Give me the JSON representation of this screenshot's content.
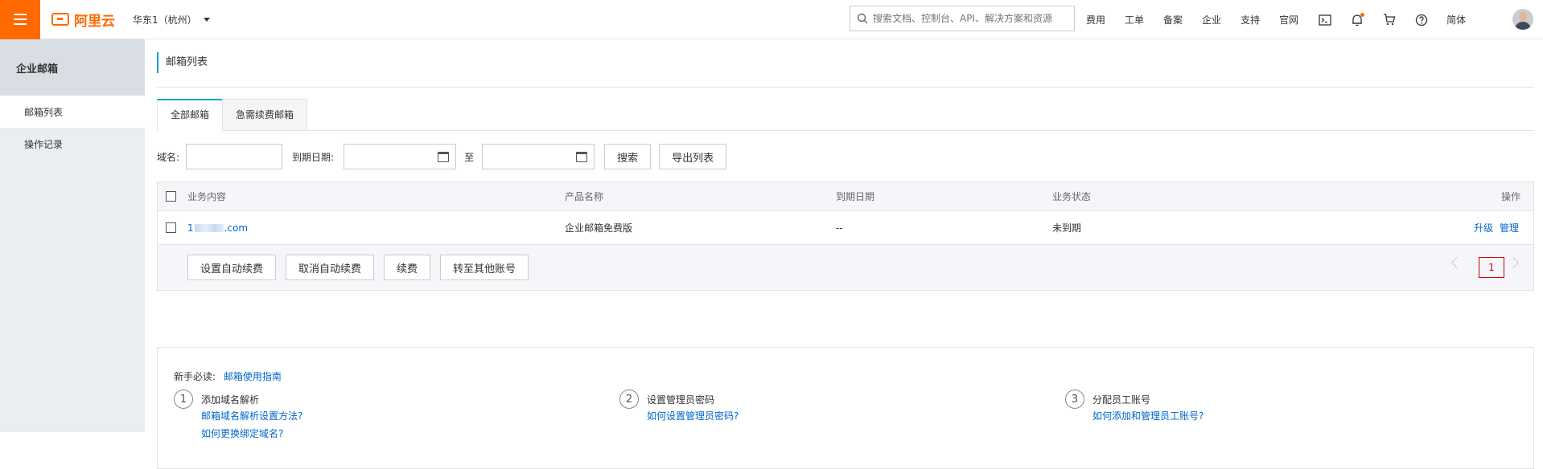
{
  "header": {
    "logo_text": "阿里云",
    "region": "华东1（杭州）",
    "search_placeholder": "搜索文档、控制台、API、解决方案和资源",
    "nav": [
      "费用",
      "工单",
      "备案",
      "企业",
      "支持",
      "官网"
    ],
    "lang": "简体",
    "icons": [
      "terminal-icon",
      "bell-icon",
      "cart-icon",
      "help-icon"
    ],
    "accent_color": "#ff6a00"
  },
  "sidebar": {
    "title": "企业邮箱",
    "items": [
      {
        "label": "邮箱列表",
        "active": true
      },
      {
        "label": "操作记录",
        "active": false
      }
    ]
  },
  "main": {
    "page_title": "邮箱列表",
    "tabs": [
      {
        "label": "全部邮箱",
        "active": true
      },
      {
        "label": "急需续费邮箱",
        "active": false
      }
    ],
    "filter": {
      "domain_label": "域名:",
      "domain_value": "",
      "date_label": "到期日期:",
      "date_from": "",
      "to_label": "至",
      "date_to": "",
      "search_button": "搜索",
      "export_button": "导出列表"
    },
    "table": {
      "columns": [
        "业务内容",
        "产品名称",
        "到期日期",
        "业务状态",
        "操作"
      ],
      "rows": [
        {
          "domain_prefix": "1",
          "domain_suffix": ".com",
          "product": "企业邮箱免费版",
          "expiry": "--",
          "status": "未到期",
          "actions": [
            "升级",
            "管理"
          ]
        }
      ],
      "footer_buttons": [
        "设置自动续费",
        "取消自动续费",
        "续费",
        "转至其他账号"
      ],
      "current_page": "1"
    },
    "guide": {
      "head_label": "新手必读:",
      "head_link": "邮箱使用指南",
      "steps": [
        {
          "num": "1",
          "title": "添加域名解析",
          "links": [
            "邮箱域名解析设置方法?",
            "如何更换绑定域名?"
          ]
        },
        {
          "num": "2",
          "title": "设置管理员密码",
          "links": [
            "如何设置管理员密码?"
          ]
        },
        {
          "num": "3",
          "title": "分配员工账号",
          "links": [
            "如何添加和管理员工账号?"
          ]
        }
      ]
    }
  }
}
